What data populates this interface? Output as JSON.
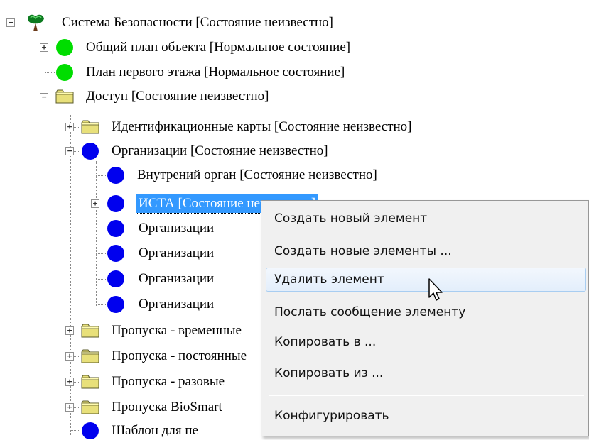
{
  "tree": {
    "nodes": [
      {
        "label": "Система Безопасности [Состояние неизвестно]",
        "icon": "tree-icon",
        "expander": "−"
      },
      {
        "label": "Общий план объекта [Нормальное состояние]",
        "icon": "green-circle-icon",
        "expander": "+"
      },
      {
        "label": "План первого этажа [Нормальное состояние]",
        "icon": "green-circle-icon"
      },
      {
        "label": "Доступ [Состояние неизвестно]",
        "icon": "folder-icon",
        "expander": "−"
      },
      {
        "label": "Идентификационные карты [Состояние неизвестно]",
        "icon": "folder-icon",
        "expander": "+"
      },
      {
        "label": "Организации [Состояние неизвестно]",
        "icon": "blue-circle-icon",
        "expander": "−"
      },
      {
        "label": "Внутрений орган [Состояние неизвестно]",
        "icon": "blue-circle-icon"
      },
      {
        "label": "ИСТА [Состояние неизвестно]",
        "icon": "blue-circle-icon",
        "expander": "+",
        "selected": true
      },
      {
        "label": "Организации",
        "icon": "blue-circle-icon"
      },
      {
        "label": "Организации",
        "icon": "blue-circle-icon"
      },
      {
        "label": "Организации",
        "icon": "blue-circle-icon"
      },
      {
        "label": "Организации",
        "icon": "blue-circle-icon"
      },
      {
        "label": "Пропуска - временные",
        "icon": "folder-icon",
        "expander": "+"
      },
      {
        "label": "Пропуска - постоянные",
        "icon": "folder-icon",
        "expander": "+"
      },
      {
        "label": "Пропуска - разовые",
        "icon": "folder-icon",
        "expander": "+"
      },
      {
        "label": "Пропуска BioSmart",
        "icon": "folder-icon",
        "expander": "+"
      },
      {
        "label": "Шаблон для пе",
        "icon": "blue-circle-icon"
      }
    ]
  },
  "context_menu": {
    "items": [
      {
        "label": "Создать новый элемент"
      },
      {
        "label": "Создать новые элементы ..."
      },
      {
        "label": "Удалить элемент",
        "hover": true
      },
      {
        "label": "Послать сообщение элементу"
      },
      {
        "label": "Копировать в ..."
      },
      {
        "label": "Копировать из ..."
      },
      {
        "label": "Конфигурировать"
      }
    ]
  },
  "colors": {
    "selection": "#3399ff",
    "green": "#00dd00",
    "blue": "#0000ee",
    "folder": "#e8e07a"
  }
}
